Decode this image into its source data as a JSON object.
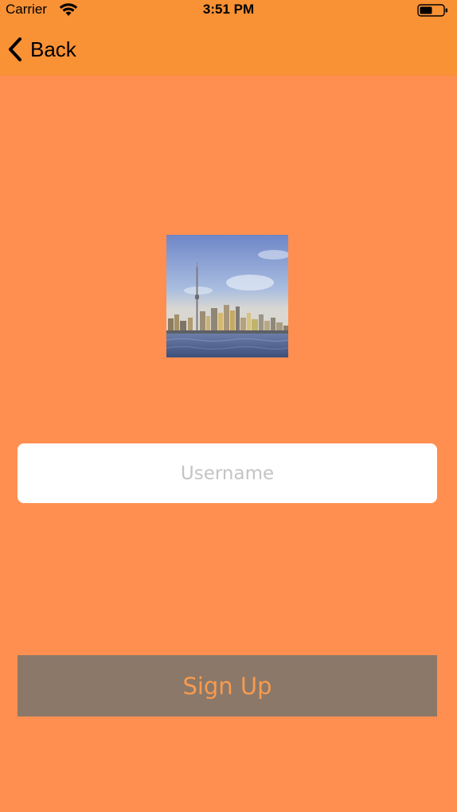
{
  "status_bar": {
    "carrier": "Carrier",
    "time": "3:51 PM",
    "icons": [
      "wifi-icon",
      "battery-icon"
    ]
  },
  "nav": {
    "back_label": "Back",
    "back_icon": "chevron-left-icon"
  },
  "form": {
    "username_placeholder": "Username",
    "username_value": "",
    "signup_label": "Sign Up"
  },
  "colors": {
    "background": "#FF8F50",
    "nav_bar": "#F99135",
    "button_background": "#8B7869",
    "button_text": "#F79B4E",
    "input_background": "#FFFFFF"
  }
}
